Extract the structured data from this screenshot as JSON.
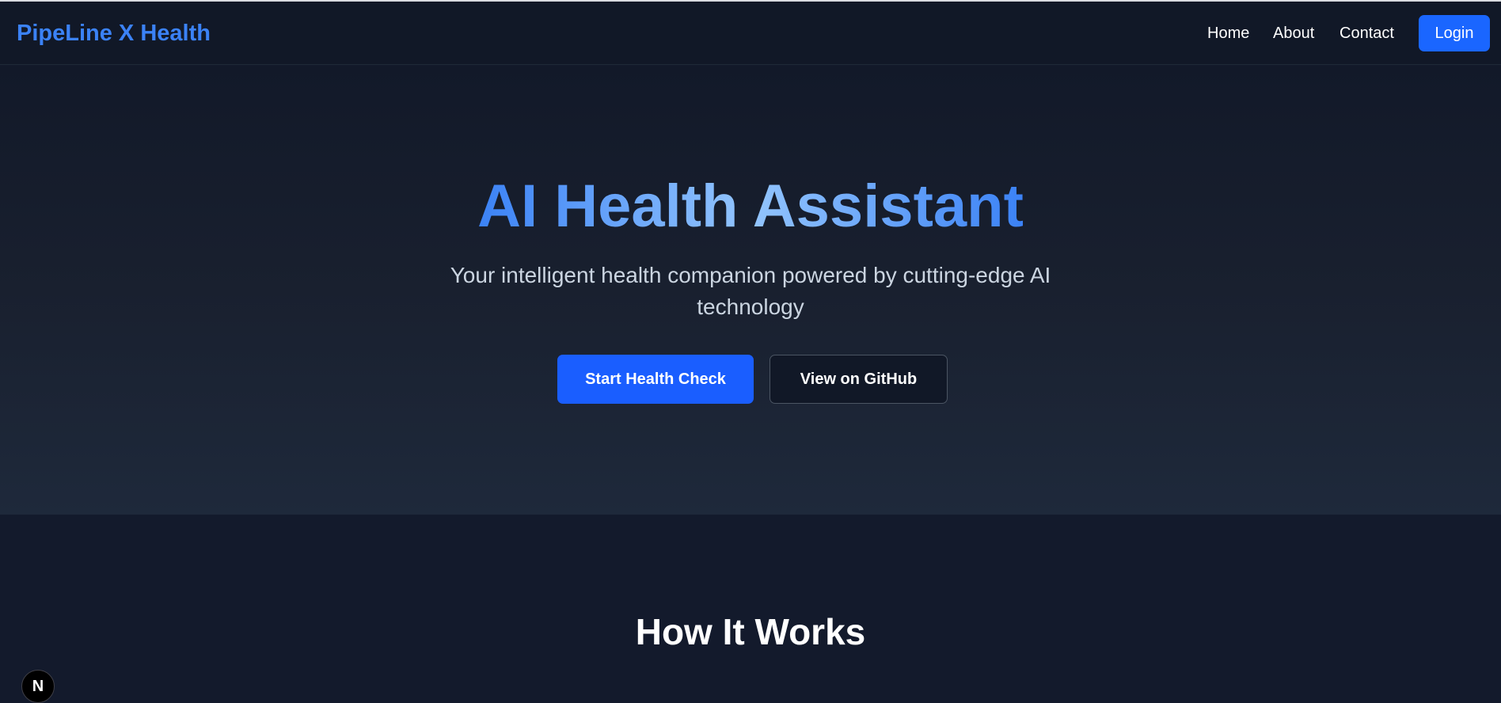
{
  "navbar": {
    "brand": "PipeLine X Health",
    "links": [
      "Home",
      "About",
      "Contact"
    ],
    "login_label": "Login"
  },
  "hero": {
    "title": "AI Health Assistant",
    "subtitle": "Your intelligent health companion powered by cutting-edge AI technology",
    "primary_button": "Start Health Check",
    "secondary_button": "View on GitHub"
  },
  "how_it_works": {
    "title": "How It Works"
  },
  "dev_badge": {
    "letter": "N",
    "icon": "nextjs-icon"
  },
  "colors": {
    "accent": "#1a5eff",
    "brand": "#3b82f6",
    "background": "#131a2c"
  }
}
